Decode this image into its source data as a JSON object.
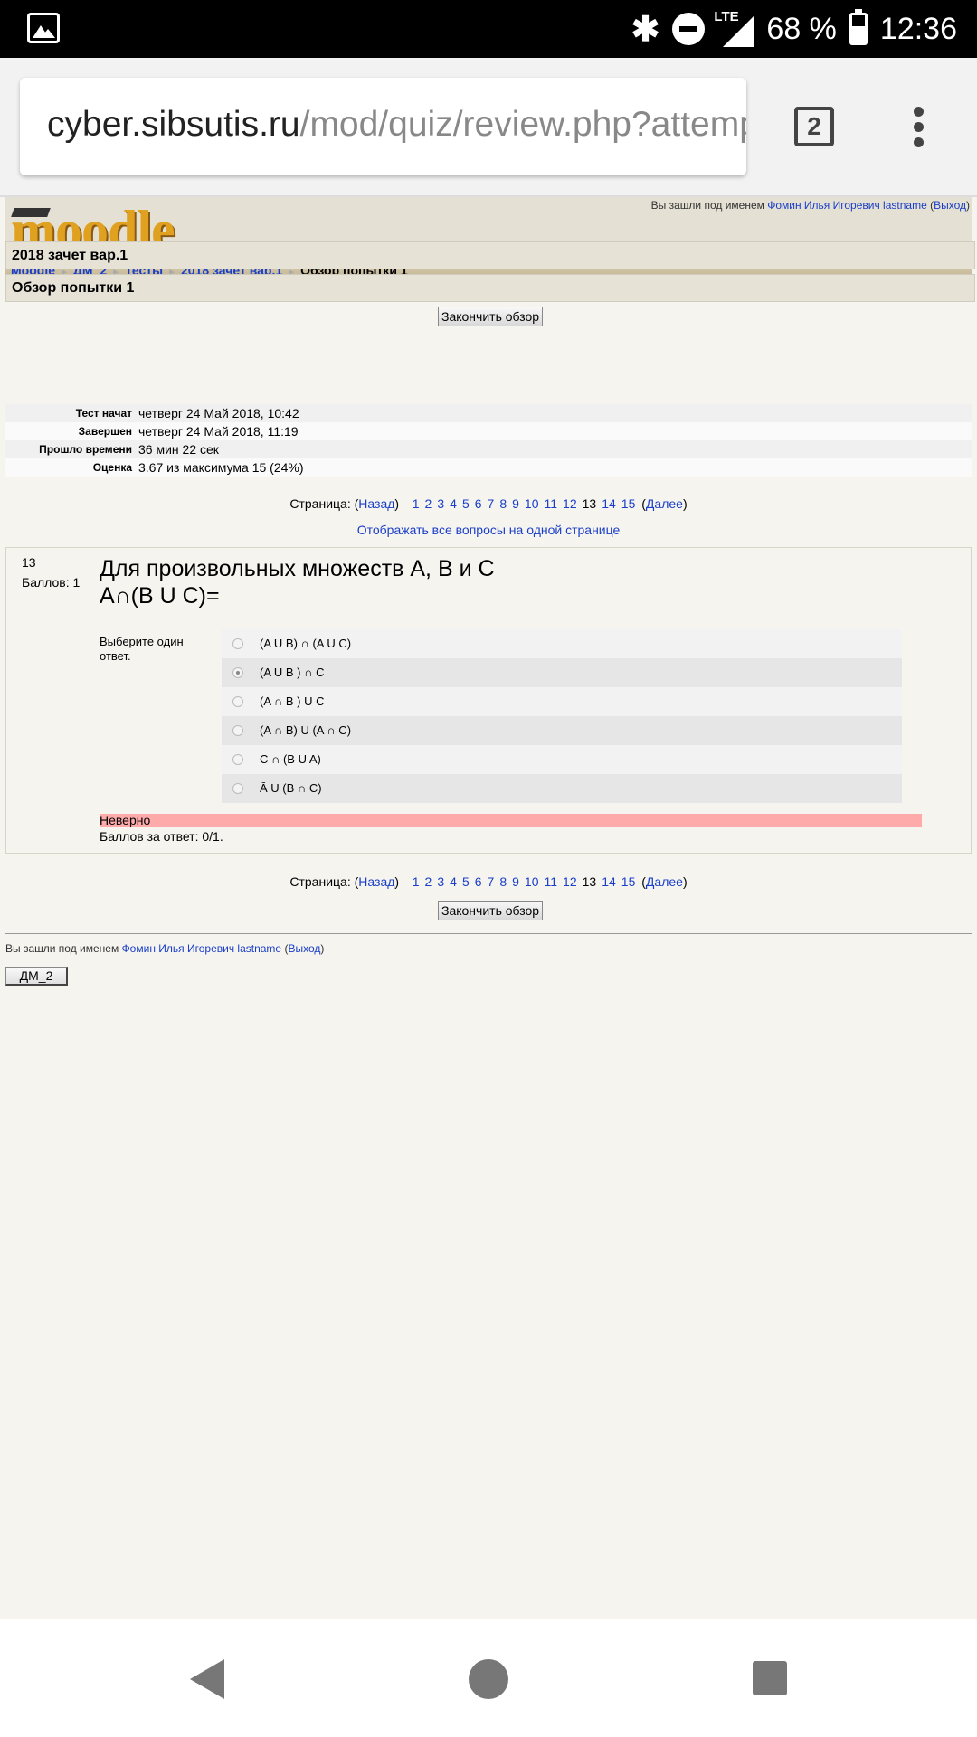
{
  "status_bar": {
    "battery": "68 %",
    "time": "12:36",
    "network": "LTE"
  },
  "browser": {
    "url_host": "cyber.sibsutis.ru",
    "url_path": "/mod/quiz/review.php?attemp",
    "tab_count": "2"
  },
  "header": {
    "logo": "moodle",
    "login_prefix": "Вы зашли под именем ",
    "user_name": "Фомин Илья Игоревич lastname",
    "logout": "Выход"
  },
  "breadcrumb": [
    "Moodle",
    "ДМ_2",
    "Тесты",
    "2018 зачет вар.1",
    "Обзор попытки 1"
  ],
  "quiz_title": "2018 зачет вар.1",
  "attempt_title": "Обзор попытки 1",
  "finish_review_label": "Закончить обзор",
  "summary": [
    {
      "label": "Тест начат",
      "value": "четверг 24 Май 2018, 10:42"
    },
    {
      "label": "Завершен",
      "value": "четверг 24 Май 2018, 11:19"
    },
    {
      "label": "Прошло времени",
      "value": "36 мин 22 сек"
    },
    {
      "label": "Оценка",
      "value": "3.67 из максимума 15 (24%)"
    }
  ],
  "paging": {
    "prefix": "Страница: (",
    "prev": "Назад",
    "next": "Далее",
    "pages": [
      "1",
      "2",
      "3",
      "4",
      "5",
      "6",
      "7",
      "8",
      "9",
      "10",
      "11",
      "12",
      "13",
      "14",
      "15"
    ],
    "current": "13"
  },
  "show_all_label": "Отображать все вопросы на одной странице",
  "question": {
    "number": "13",
    "score": "Баллов: 1",
    "text_line1": "Для произвольных множеств А, В и С",
    "text_line2": "А∩(В U С)=",
    "prompt": "Выберите один ответ.",
    "answers": [
      {
        "text": "(A U B) ∩ (A U C)",
        "checked": false
      },
      {
        "text": "(A U B ) ∩ C",
        "checked": true
      },
      {
        "text": "(A ∩ B ) U C",
        "checked": false
      },
      {
        "text": "(A ∩ B) U (A ∩ C)",
        "checked": false
      },
      {
        "text": "C ∩ (B U A)",
        "checked": false
      },
      {
        "text": "Ā U (B ∩ C)",
        "checked": false
      }
    ],
    "verdict": "Неверно",
    "mark": "Баллов за ответ: 0/1."
  },
  "course_button_label": "ДМ_2",
  "colors": {
    "link": "#1a3ec8",
    "incorrect_bg": "#ffaaaa",
    "header_bg": "#e4e0d4"
  }
}
